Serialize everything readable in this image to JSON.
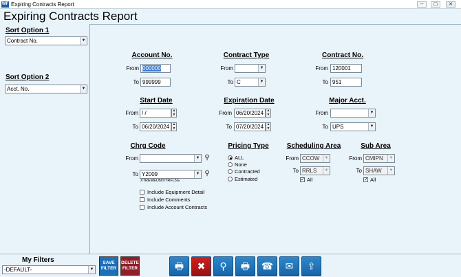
{
  "window": {
    "app_logo": "WF",
    "title": "Expiring Contracts Report",
    "min": "─",
    "max": "▢",
    "close": "✕"
  },
  "heading": "Expiring Contracts Report",
  "sort1": {
    "label": "Sort Option 1",
    "value": "Contract No."
  },
  "sort2": {
    "label": "Sort Option 2",
    "value": "Acct. No."
  },
  "account": {
    "title": "Account No.",
    "from_label": "From",
    "from": "000000",
    "to_label": "To",
    "to": "999999"
  },
  "ctype": {
    "title": "Contract Type",
    "from_label": "From",
    "from": "",
    "to_label": "To",
    "to": "C"
  },
  "cno": {
    "title": "Contract No.",
    "from_label": "From",
    "from": "120001",
    "to_label": "To",
    "to": "951"
  },
  "start": {
    "title": "Start Date",
    "from_label": "From",
    "from": " / /",
    "to_label": "To",
    "to": "06/20/2024"
  },
  "expire": {
    "title": "Expiration Date",
    "from_label": "From",
    "from": "06/20/2024",
    "to_label": "To",
    "to": "07/20/2024"
  },
  "major": {
    "title": "Major Acct.",
    "from_label": "From",
    "from": "",
    "to_label": "To",
    "to": "UPS"
  },
  "chrg": {
    "title": "Chrg Code",
    "from_label": "From",
    "from": "",
    "to_label": "To",
    "to": "Y2009",
    "desc": "XTREMEUNIVTRFL5G"
  },
  "pricing": {
    "title": "Pricing Type",
    "options": [
      "ALL",
      "None",
      "Contracted",
      "Estimated"
    ]
  },
  "sched": {
    "title": "Scheduling Area",
    "from_label": "From",
    "from": "CCOW",
    "to_label": "To",
    "to": "RRLS",
    "all": "All"
  },
  "subarea": {
    "title": "Sub Area",
    "from_label": "From",
    "from": "CMIPN",
    "to_label": "To",
    "to": "SHAW",
    "all": "All"
  },
  "includes": [
    "Include Equipment Detail",
    "Include Comments",
    "Include Account Contracts"
  ],
  "filters": {
    "label": "My Filters",
    "value": "-DEFAULT-",
    "save": "SAVE FILTER",
    "delete": "DELETE FILTER"
  },
  "icons": {
    "print": "printer-icon",
    "cancel": "x-icon",
    "preview": "magnifier-icon",
    "print_setup": "printer-question-icon",
    "fax": "fax-icon",
    "email": "envelope-icon",
    "export": "upload-icon"
  }
}
